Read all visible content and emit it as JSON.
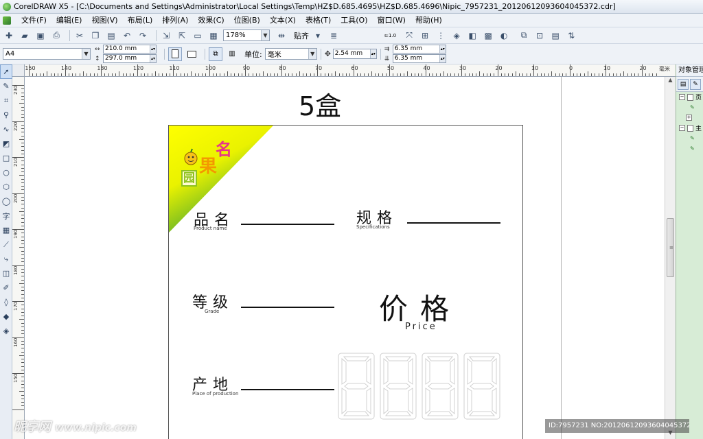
{
  "window": {
    "title": "CorelDRAW X5 - [C:\\Documents and Settings\\Administrator\\Local Settings\\Temp\\HZ$D.685.4695\\HZ$D.685.4696\\Nipic_7957231_20120612093604045372.cdr]"
  },
  "menu": [
    "文件(F)",
    "编辑(E)",
    "视图(V)",
    "布局(L)",
    "排列(A)",
    "效果(C)",
    "位图(B)",
    "文本(X)",
    "表格(T)",
    "工具(O)",
    "窗口(W)",
    "帮助(H)"
  ],
  "toolbar": {
    "zoom": "178%",
    "snap_label": "贴齐",
    "scale_label": "s:1.0"
  },
  "property_bar": {
    "paper_size": "A4",
    "width": "210.0 mm",
    "height": "297.0 mm",
    "unit_label": "单位:",
    "unit": "毫米",
    "nudge": "2.54 mm",
    "dup_x": "6.35 mm",
    "dup_y": "6.35 mm"
  },
  "hruler_labels": [
    "150",
    "140",
    "130",
    "120",
    "110",
    "100",
    "90",
    "80",
    "70",
    "60",
    "50",
    "40",
    "30",
    "20",
    "10",
    "0",
    "10",
    "20"
  ],
  "hruler_unit": "毫米",
  "vruler_labels": [
    "230",
    "220",
    "210",
    "200",
    "190",
    "180",
    "170",
    "160",
    "150"
  ],
  "docker": {
    "title": "对象管理器",
    "rows": [
      "页",
      "主"
    ]
  },
  "document": {
    "title": "5盒",
    "logo_chars": [
      "名",
      "果",
      "园"
    ],
    "fields": [
      {
        "cn": "品名",
        "en": "Product name"
      },
      {
        "cn": "规格",
        "en": "Specifications"
      },
      {
        "cn": "等级",
        "en": "Grade"
      },
      {
        "cn": "产地",
        "en": "Place of production"
      }
    ],
    "price_cn": "价格",
    "price_en": "Price",
    "digit_count": 4
  },
  "watermark": {
    "brand": "昵享网",
    "url": "www.nipic.com",
    "id_text": "ID:7957231 NO:20120612093604045372"
  },
  "colors": {
    "corner_yellow": "#ffff00",
    "corner_green": "#3aa63a",
    "logo_pink": "#e6348a",
    "logo_orange": "#f39800"
  }
}
